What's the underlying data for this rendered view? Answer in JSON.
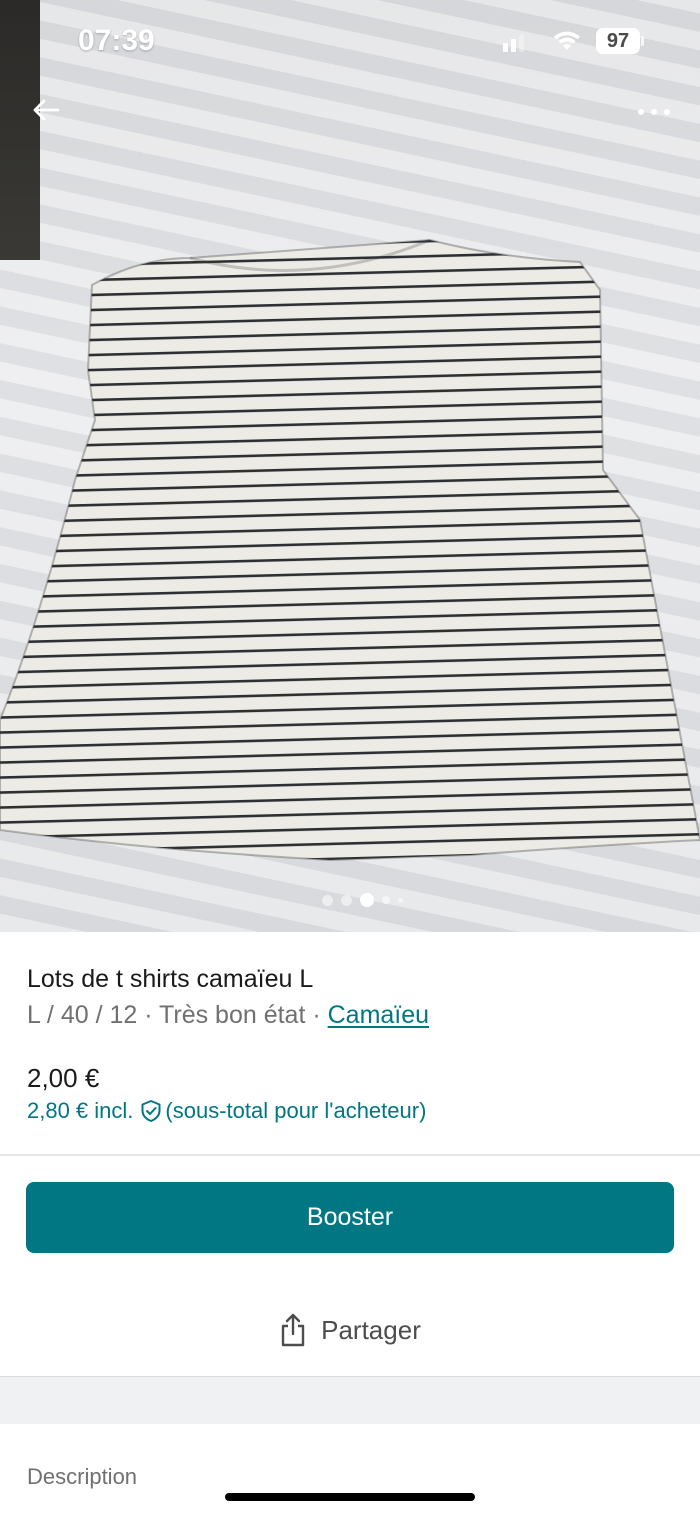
{
  "status_bar": {
    "time": "07:39",
    "battery": "97"
  },
  "photo": {
    "icons": {
      "back": "arrow-left-icon",
      "more": "more-horizontal-icon"
    },
    "carousel": {
      "total_dots": 5,
      "active_index": 2
    }
  },
  "item": {
    "title": "Lots de t shirts camaïeu L",
    "meta": "L / 40 / 12 · Très bon état · ",
    "brand": "Camaïeu",
    "price": "2,00 €",
    "buyer_price": "2,80 € incl.",
    "buyer_price_note": "(sous-total pour l'acheteur)"
  },
  "actions": {
    "booster_label": "Booster",
    "share_label": "Partager"
  },
  "sections": {
    "description_label": "Description"
  },
  "colors": {
    "accent": "#007782",
    "text_primary": "#1a1a1a",
    "text_secondary": "#707070"
  }
}
